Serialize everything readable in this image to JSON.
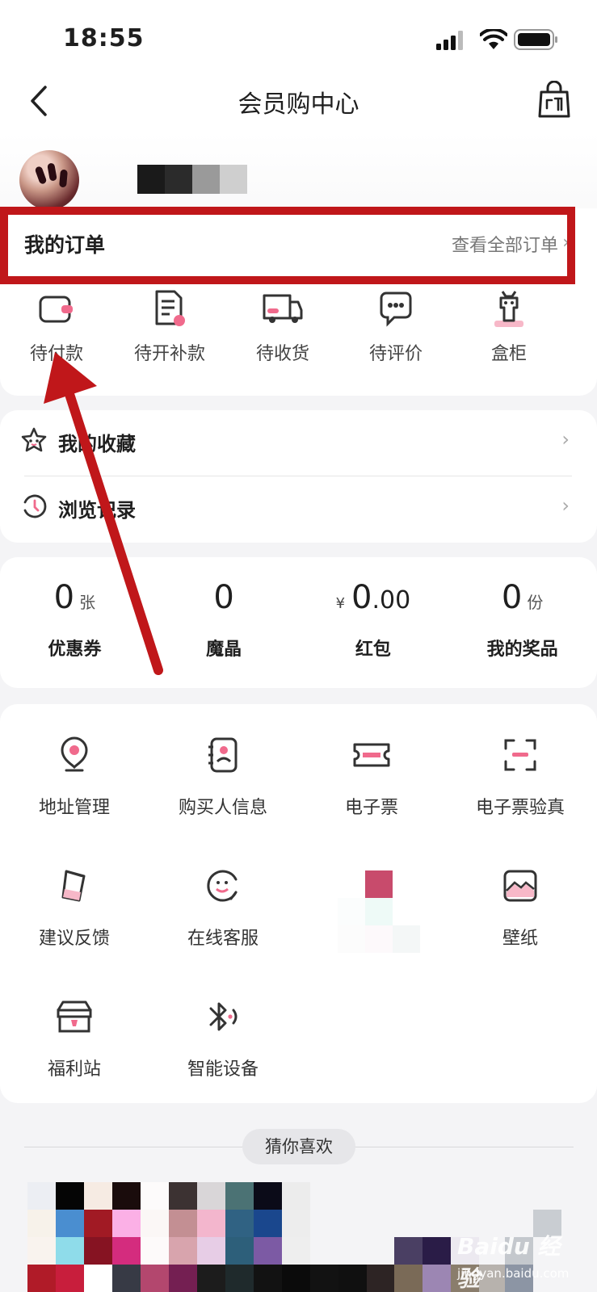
{
  "status_bar": {
    "time": "18:55"
  },
  "nav": {
    "title": "会员购中心"
  },
  "orders": {
    "title": "我的订单",
    "view_all": "查看全部订单",
    "tabs": [
      {
        "label": "待付款",
        "icon": "wallet-icon"
      },
      {
        "label": "待开补款",
        "icon": "document-icon"
      },
      {
        "label": "待收货",
        "icon": "truck-icon"
      },
      {
        "label": "待评价",
        "icon": "chat-bubble-icon"
      },
      {
        "label": "盒柜",
        "icon": "figure-icon"
      }
    ]
  },
  "links": [
    {
      "label": "我的收藏",
      "icon": "star-face-icon"
    },
    {
      "label": "浏览记录",
      "icon": "history-clock-icon"
    }
  ],
  "stats": [
    {
      "value": "0",
      "unit": "张",
      "label": "优惠券"
    },
    {
      "value": "0",
      "unit": "",
      "label": "魔晶"
    },
    {
      "currency": "¥",
      "value": "0",
      "decimals": ".00",
      "label": "红包"
    },
    {
      "value": "0",
      "unit": "份",
      "label": "我的奖品"
    }
  ],
  "tools": [
    {
      "label": "地址管理",
      "icon": "location-pin-icon"
    },
    {
      "label": "购买人信息",
      "icon": "contact-book-icon"
    },
    {
      "label": "电子票",
      "icon": "ticket-icon"
    },
    {
      "label": "电子票验真",
      "icon": "scan-frame-icon"
    },
    {
      "label": "建议反馈",
      "icon": "feedback-cup-icon"
    },
    {
      "label": "在线客服",
      "icon": "customer-service-icon"
    },
    {
      "label": "",
      "icon": "pixelated-icon"
    },
    {
      "label": "壁纸",
      "icon": "wallpaper-image-icon"
    },
    {
      "label": "福利站",
      "icon": "gift-box-icon"
    },
    {
      "label": "智能设备",
      "icon": "bluetooth-icon"
    }
  ],
  "recommend": {
    "title": "猜你喜欢"
  },
  "watermark": {
    "main": "Baidu 经验",
    "sub": "jingyan.baidu.com"
  },
  "colors": {
    "accent_pink": "#f06a8c",
    "annotation_red": "#c0171a"
  }
}
